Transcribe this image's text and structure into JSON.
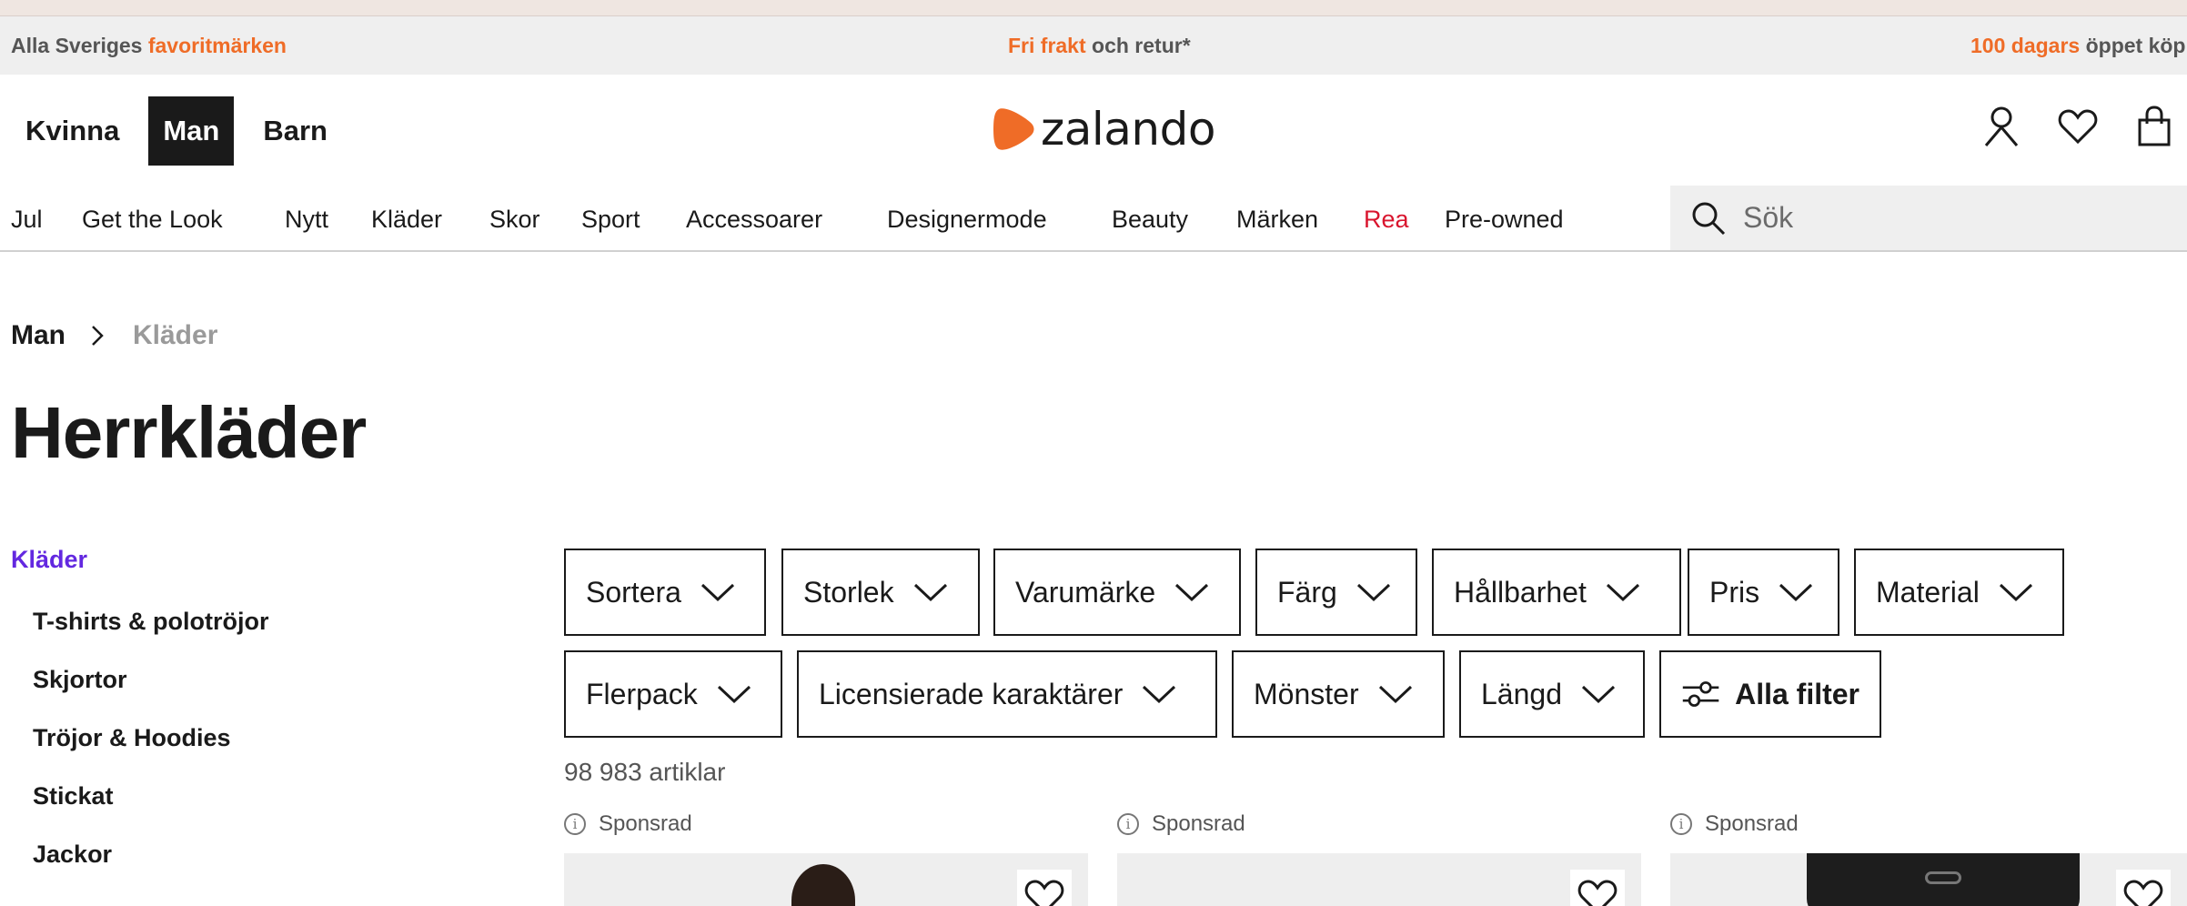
{
  "promo": {
    "left_text": "Alla Sveriges ",
    "left_accent": "favoritmärken",
    "center_accent": "Fri frakt",
    "center_text": " och retur*",
    "right_accent": "100 dagars",
    "right_text": " öppet köp"
  },
  "gender_nav": [
    {
      "label": "Kvinna",
      "active": false
    },
    {
      "label": "Man",
      "active": true
    },
    {
      "label": "Barn",
      "active": false
    }
  ],
  "logo": {
    "text": "zalando",
    "color": "#ef6c27"
  },
  "header_icons": [
    "account-icon",
    "wishlist-heart-icon",
    "shopping-bag-icon"
  ],
  "category_nav": [
    {
      "label": "Jul"
    },
    {
      "label": "Get the Look"
    },
    {
      "label": "Nytt"
    },
    {
      "label": "Kläder"
    },
    {
      "label": "Skor"
    },
    {
      "label": "Sport"
    },
    {
      "label": "Accessoarer"
    },
    {
      "label": "Designermode"
    },
    {
      "label": "Beauty"
    },
    {
      "label": "Märken"
    },
    {
      "label": "Rea",
      "highlight": "#d9152e"
    },
    {
      "label": "Pre-owned"
    }
  ],
  "search": {
    "placeholder": "Sök"
  },
  "breadcrumb": [
    {
      "label": "Man"
    },
    {
      "label": "Kläder"
    }
  ],
  "page_title": "Herrkläder",
  "sidebar": {
    "heading": "Kläder",
    "heading_color": "#6328e0",
    "items": [
      {
        "label": "T-shirts & polotröjor"
      },
      {
        "label": "Skjortor"
      },
      {
        "label": "Tröjor & Hoodies"
      },
      {
        "label": "Stickat"
      },
      {
        "label": "Jackor"
      }
    ]
  },
  "filters": {
    "row1": [
      {
        "label": "Sortera"
      },
      {
        "label": "Storlek"
      },
      {
        "label": "Varumärke"
      },
      {
        "label": "Färg"
      },
      {
        "label": "Hållbarhet"
      },
      {
        "label": "Pris"
      },
      {
        "label": "Material"
      }
    ],
    "row2": [
      {
        "label": "Flerpack"
      },
      {
        "label": "Licensierade karaktärer"
      },
      {
        "label": "Mönster"
      },
      {
        "label": "Längd"
      }
    ],
    "all_filters_label": "Alla filter"
  },
  "article_count": "98 983 artiklar",
  "products": [
    {
      "sponsored_label": "Sponsrad"
    },
    {
      "sponsored_label": "Sponsrad"
    },
    {
      "sponsored_label": "Sponsrad"
    }
  ]
}
